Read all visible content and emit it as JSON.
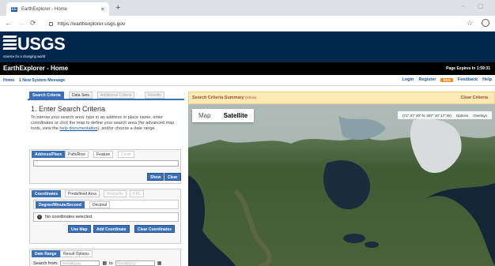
{
  "browser": {
    "tab_title": "EarthExplorer - Home",
    "favicon_text": "EE",
    "new_tab": "+",
    "url": "https://earthexplorer.usgs.gov",
    "min": "–",
    "max": "▢"
  },
  "header": {
    "logo": "USGS",
    "tagline": "science for a changing world",
    "app_title": "EarthExplorer - Home",
    "page_expires": "Page Expires In 1:59:31"
  },
  "menu": {
    "home": "Home",
    "system_message": "1 New System Message",
    "login": "Login",
    "register": "Register",
    "rss": "RSS",
    "feedback": "Feedback",
    "help": "Help"
  },
  "panel": {
    "tabs": [
      "Search Criteria",
      "Data Sets",
      "Additional Criteria",
      "Results"
    ],
    "heading": "1. Enter Search Criteria",
    "intro_before": "To narrow your search area: type in an address or place name, enter coordinates or click the map to define your search area (for advanced map tools, view the ",
    "intro_link": "help documentation",
    "intro_after": "), and/or choose a date range.",
    "address_tabs": [
      "Address/Place",
      "Path/Row",
      "Feature",
      "Circle"
    ],
    "show_btn": "Show",
    "clear_btn": "Clear",
    "coord_tabs": [
      "Coordinates",
      "Predefined Area",
      "Shapefile",
      "KML"
    ],
    "format_tabs": [
      "Degree/Minute/Second",
      "Decimal"
    ],
    "no_coords": "No coordinates selected.",
    "use_map": "Use Map",
    "add_coord": "Add Coordinate",
    "clear_coords": "Clear Coordinates",
    "date_tabs": [
      "Date Range",
      "Result Options"
    ],
    "search_from": "Search from:",
    "date_placeholder": "mm/dd/yyyy",
    "to": "to"
  },
  "summary": {
    "title": "Search Criteria Summary",
    "show": "(Show)",
    "clear": "Clear Criteria"
  },
  "map": {
    "map_label": "Map",
    "satellite_label": "Satellite",
    "coords": "(71° 07' 26\" N, 097° 20' 17\" W)",
    "options": "Options",
    "overlays": "Overlays"
  }
}
